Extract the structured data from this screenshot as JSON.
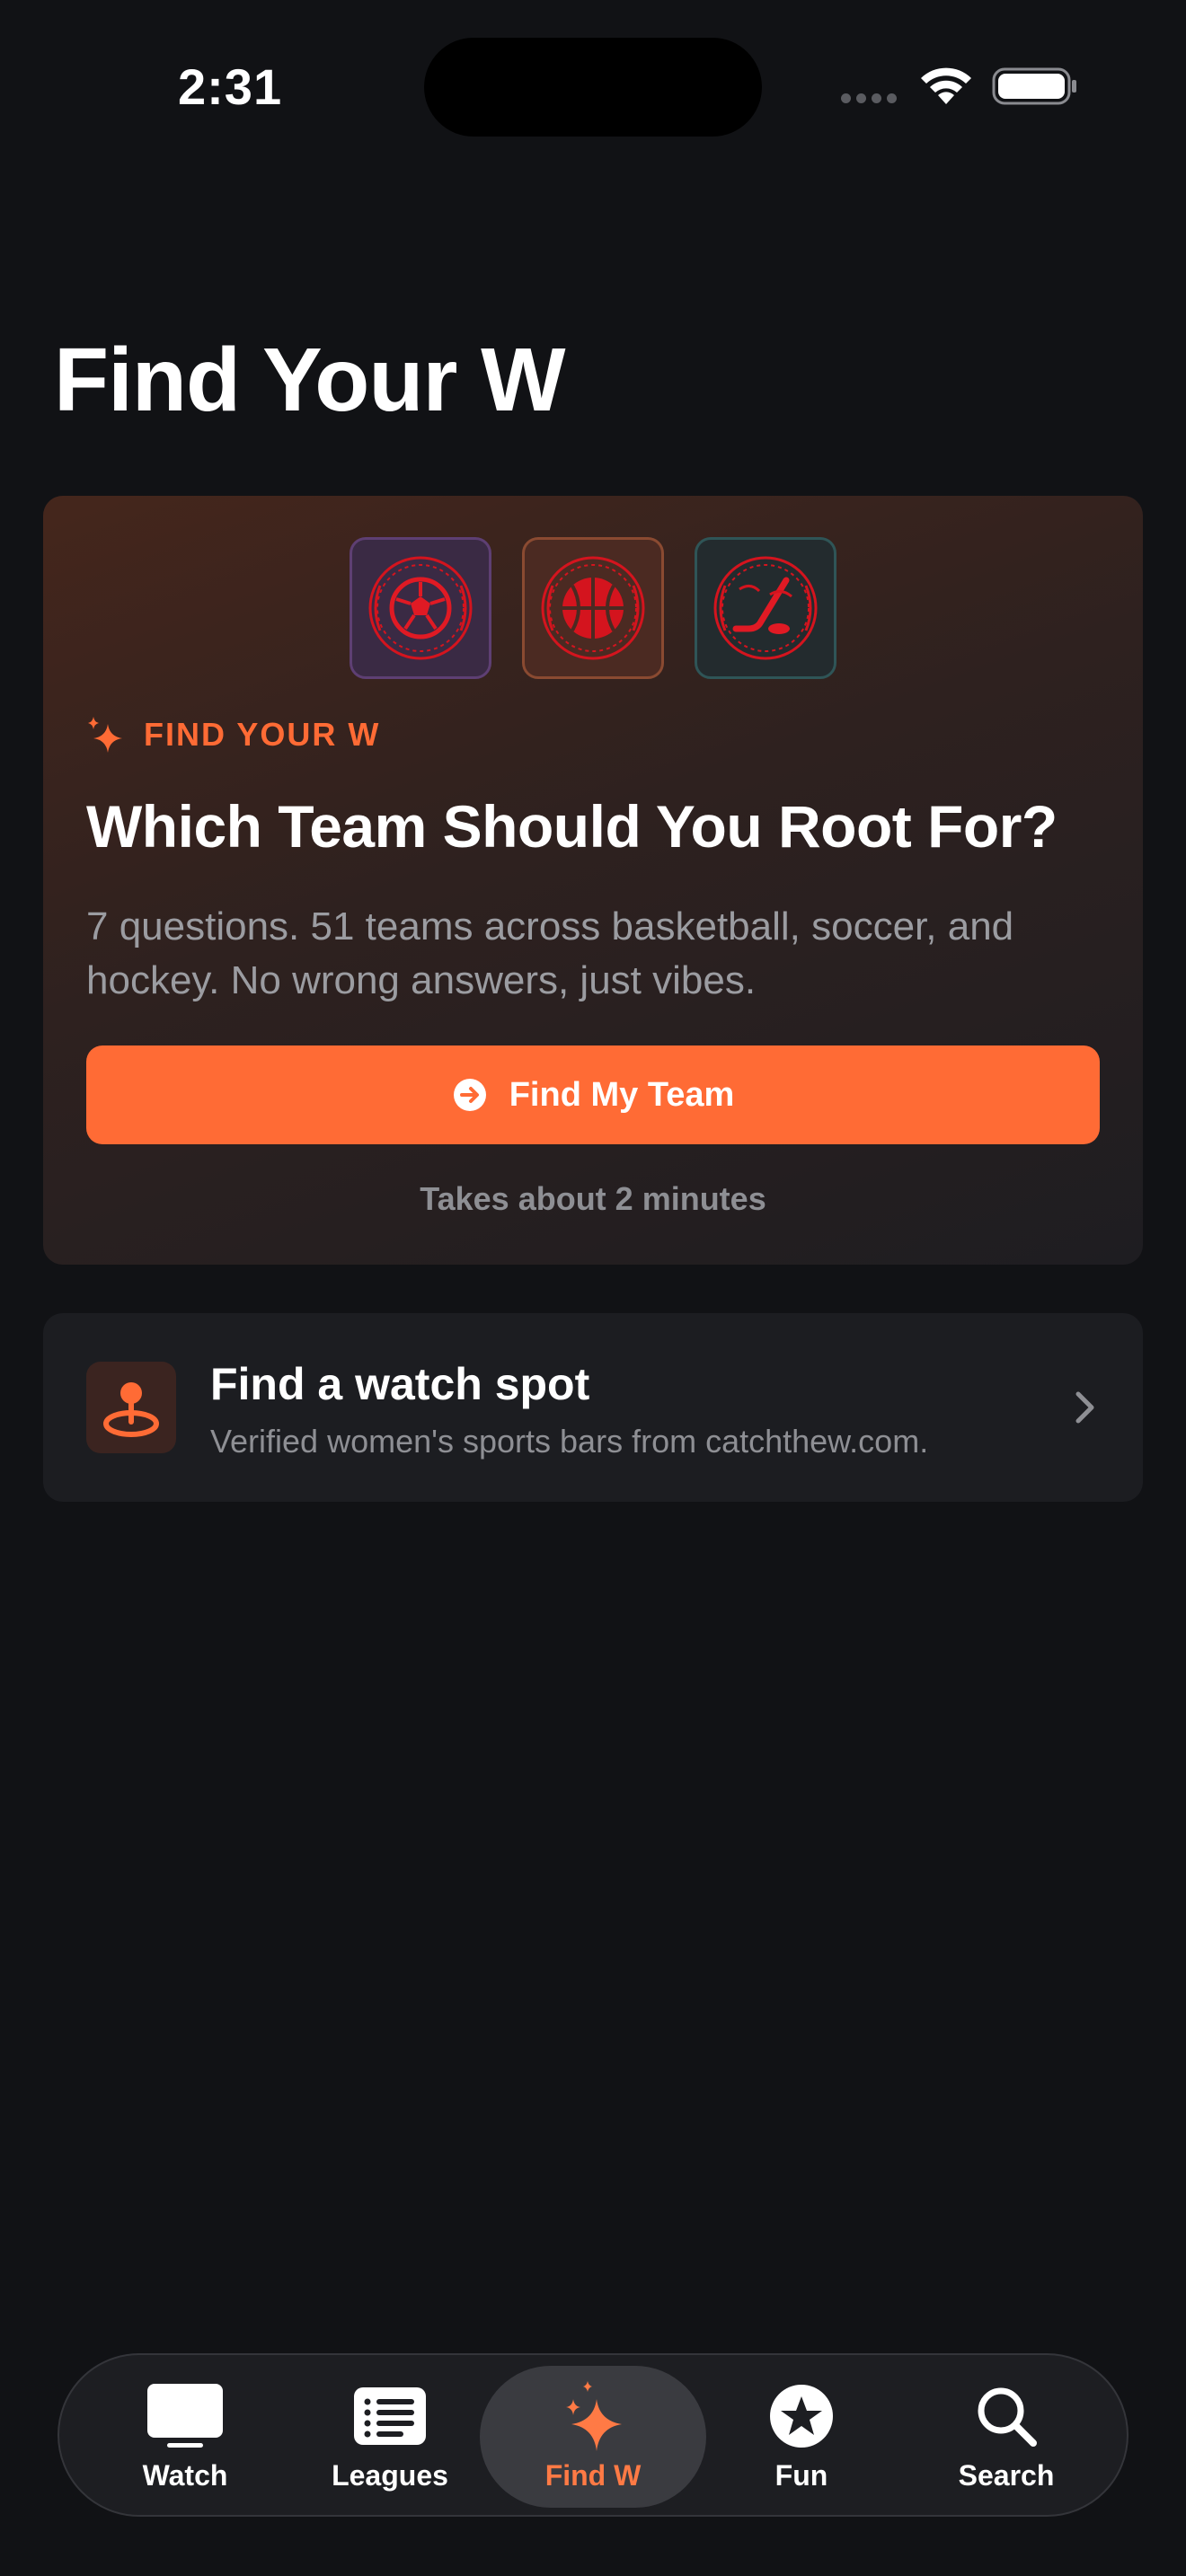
{
  "status_bar": {
    "time": "2:31"
  },
  "page": {
    "title": "Find Your W"
  },
  "hero": {
    "badges": [
      "soccer-badge-icon",
      "basketball-badge-icon",
      "hockey-badge-icon"
    ],
    "eyebrow": "FIND YOUR W",
    "title": "Which Team Should You Root For?",
    "description": "7 questions. 51 teams across basketball, soccer, and hockey. No wrong answers, just vibes.",
    "cta_label": "Find My Team",
    "note": "Takes about 2 minutes"
  },
  "watch_spot": {
    "title": "Find a watch spot",
    "subtitle": "Verified women's sports bars from catchthew.com."
  },
  "tab_bar": {
    "tabs": [
      {
        "label": "Watch",
        "icon": "tv-icon"
      },
      {
        "label": "Leagues",
        "icon": "list-icon"
      },
      {
        "label": "Find W",
        "icon": "sparkles-icon",
        "active": true
      },
      {
        "label": "Fun",
        "icon": "star-icon"
      },
      {
        "label": "Search",
        "icon": "search-icon"
      }
    ]
  },
  "colors": {
    "background": "#111215",
    "accent": "#ff6b35",
    "card": "#1c1d21",
    "muted_text": "#8e8f94"
  }
}
